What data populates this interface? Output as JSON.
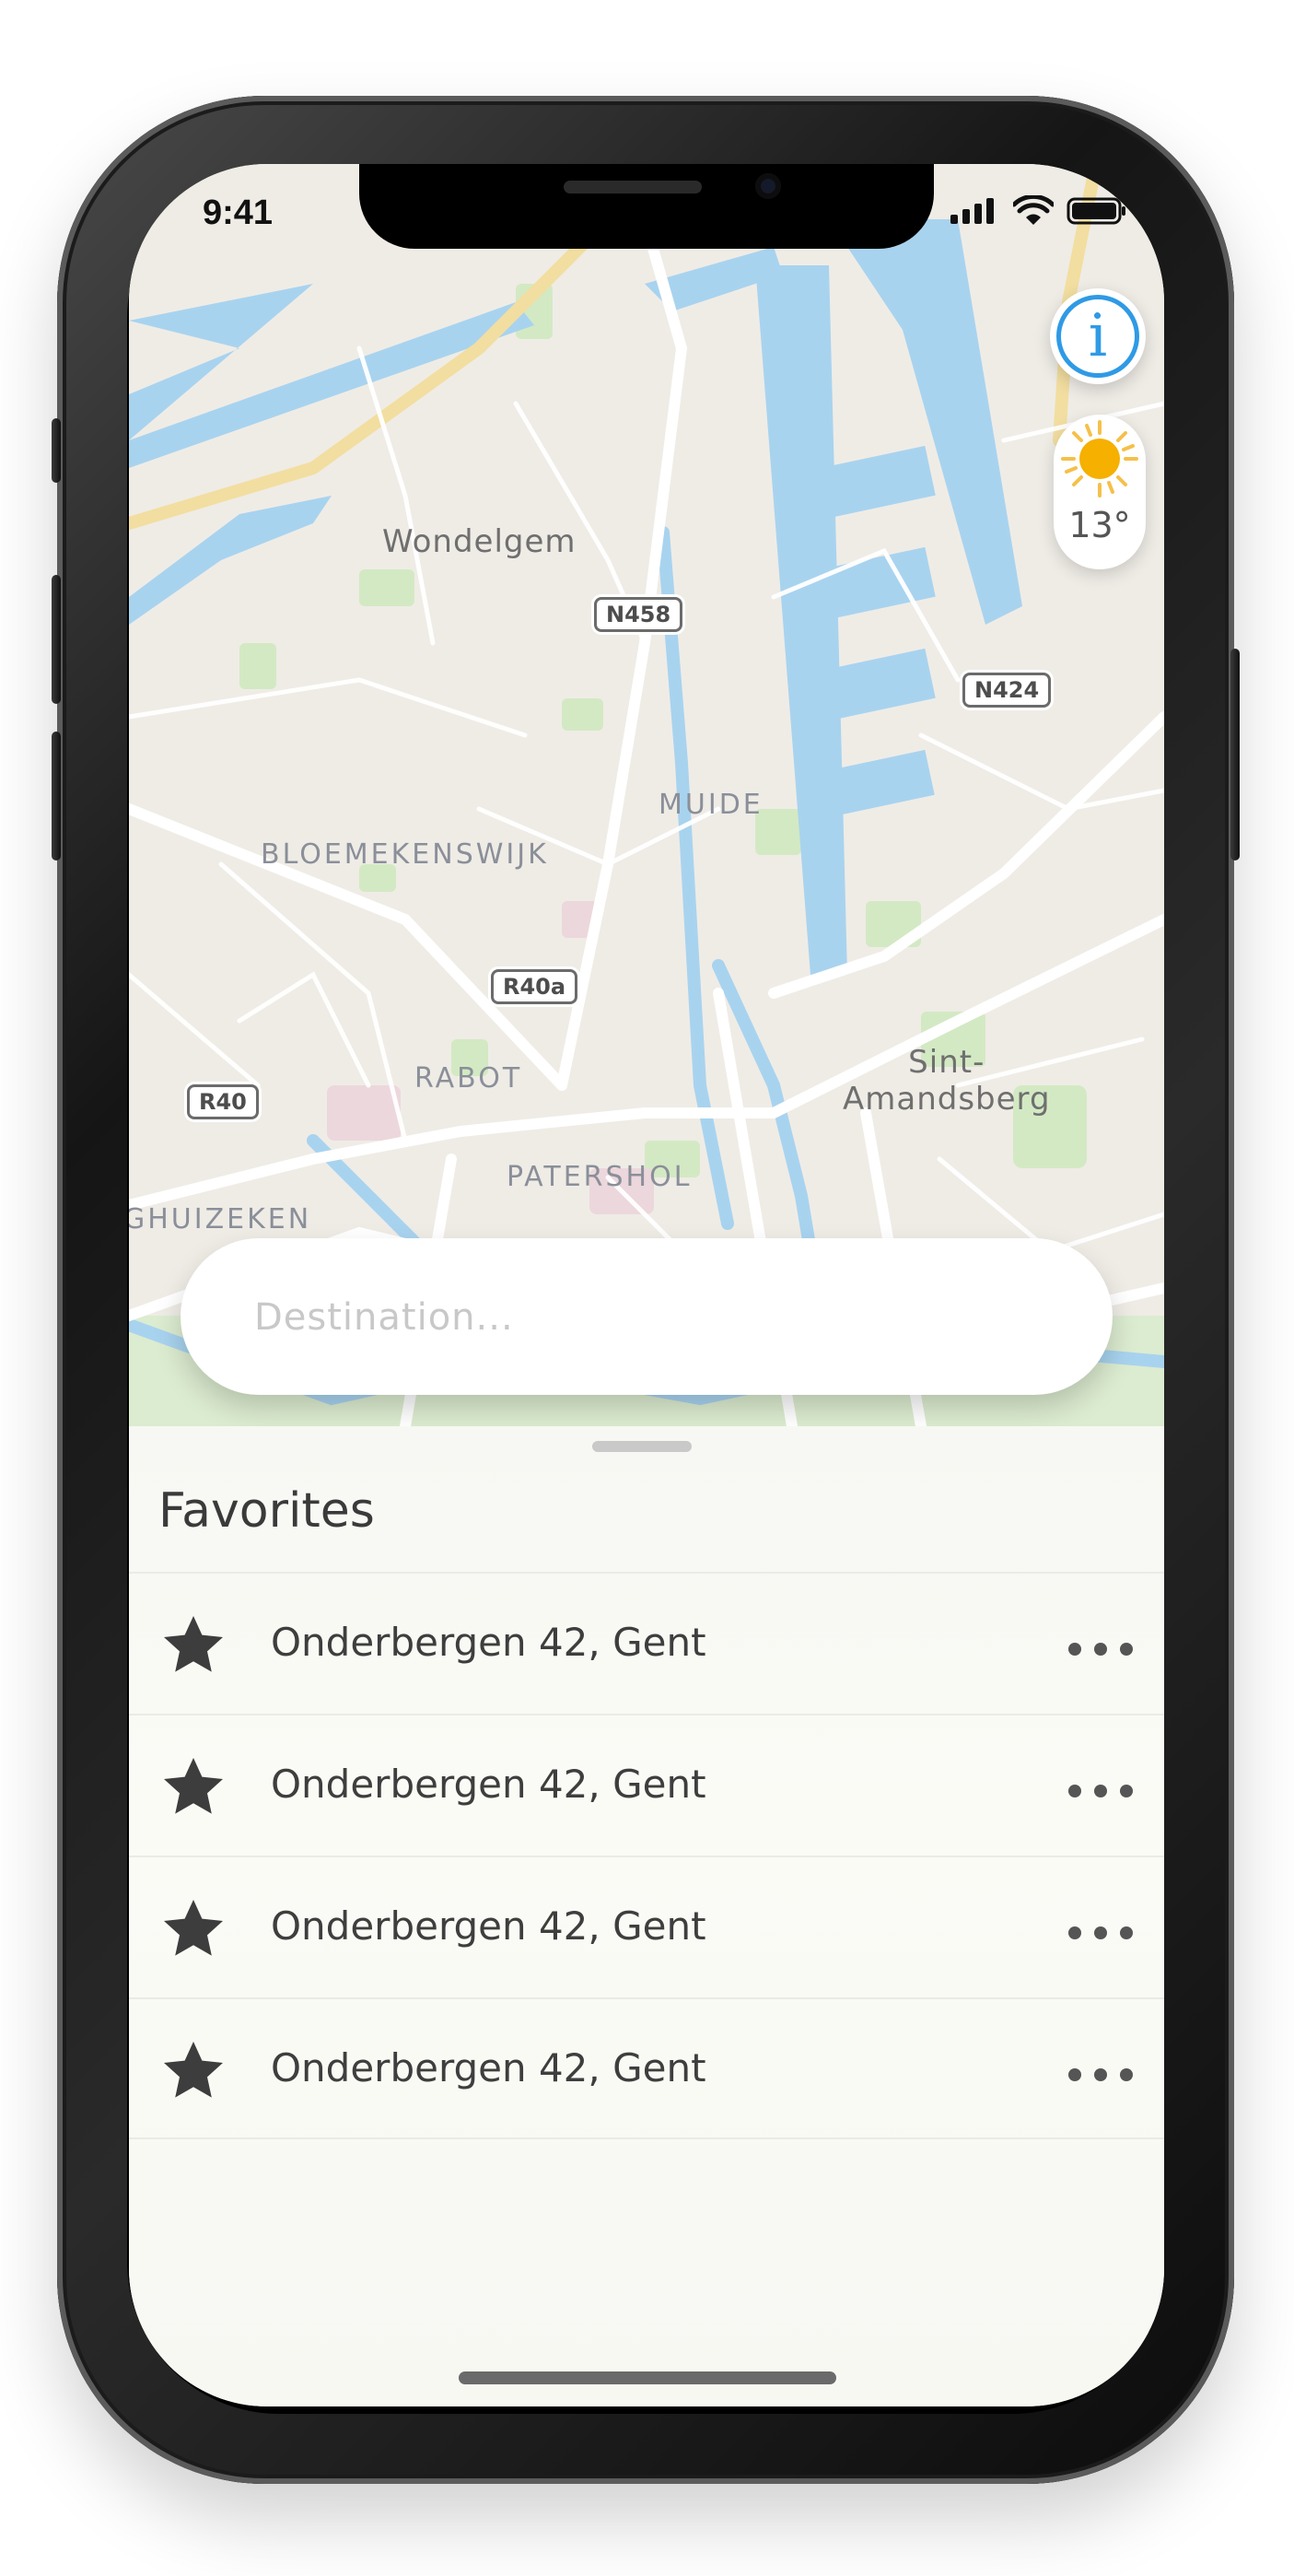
{
  "status_bar": {
    "time": "9:41"
  },
  "map": {
    "places": [
      "Wondelgem",
      "Sint-\nAmandsberg"
    ],
    "districts": [
      "MUIDE",
      "BLOEMEKENSWIJK",
      "RABOT",
      "PATERSHOL",
      "GHUIZEKEN"
    ],
    "roads": [
      "N458",
      "N424",
      "R40a",
      "R40"
    ],
    "info_icon": "info-icon",
    "weather": {
      "icon": "sun-icon",
      "temperature": "13°"
    }
  },
  "search": {
    "value": "",
    "placeholder": "Destination..."
  },
  "favorites": {
    "title": "Favorites",
    "items": [
      {
        "label": "Onderbergen 42, Gent",
        "icon": "star-icon",
        "menu_icon": "more-icon"
      },
      {
        "label": "Onderbergen 42, Gent",
        "icon": "star-icon",
        "menu_icon": "more-icon"
      },
      {
        "label": "Onderbergen 42, Gent",
        "icon": "star-icon",
        "menu_icon": "more-icon"
      },
      {
        "label": "Onderbergen 42, Gent",
        "icon": "star-icon",
        "menu_icon": "more-icon"
      }
    ]
  },
  "colors": {
    "accent": "#2f9ae5",
    "water": "#a8d3ef",
    "park": "#cfe6bd",
    "sun": "#f5b000"
  }
}
